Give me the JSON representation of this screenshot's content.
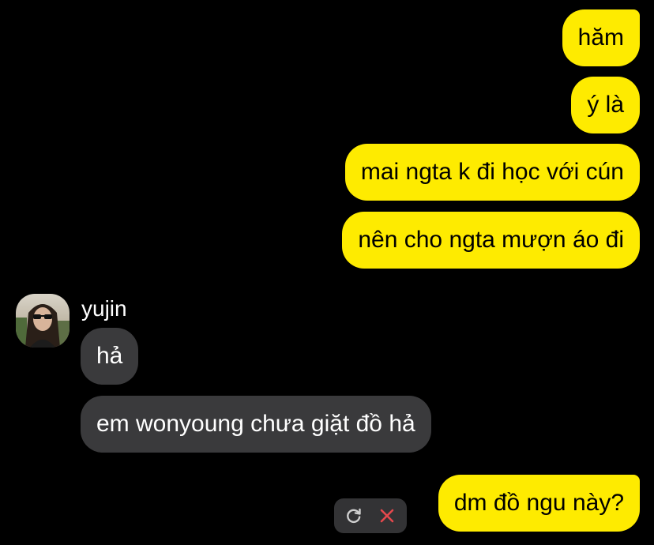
{
  "messages": {
    "sent_1": "hăm",
    "sent_2": "ý là",
    "sent_3": "mai ngta k đi học với cún",
    "sent_4": "nên cho ngta mượn áo đi",
    "received_sender": "yujin",
    "received_1": "hả",
    "received_2": "em wonyoung chưa giặt đồ hả",
    "sent_failed": "dm đồ ngu này?"
  },
  "icons": {
    "retry": "refresh-icon",
    "delete": "close-icon"
  },
  "colors": {
    "background": "#000000",
    "sent_bubble": "#FEEB00",
    "received_bubble": "#3A3A3C",
    "delete_icon": "#E5484D",
    "retry_icon": "#CFCFCF"
  }
}
